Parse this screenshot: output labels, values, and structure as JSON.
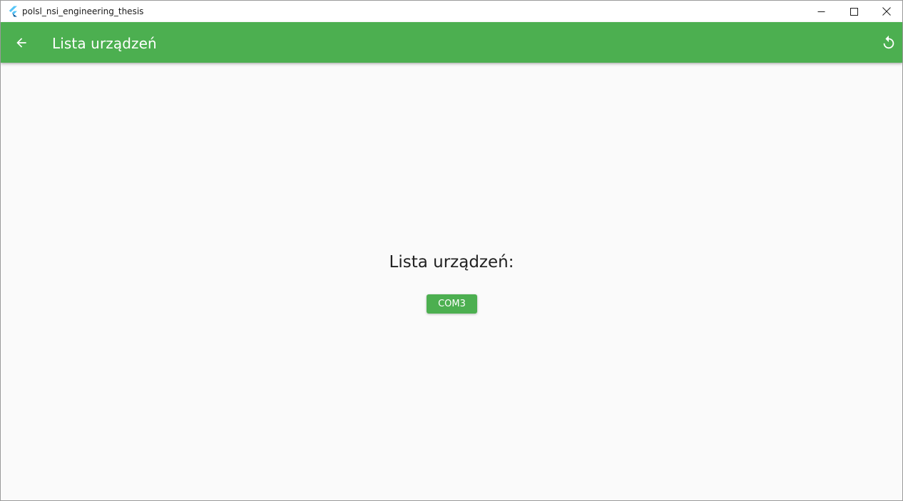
{
  "window": {
    "title": "polsl_nsi_engineering_thesis",
    "app_icon": "flutter-logo-icon",
    "controls": [
      "minimize-icon",
      "maximize-icon",
      "close-icon"
    ]
  },
  "appbar": {
    "title": "Lista urządzeń",
    "back_icon": "arrow-back-icon",
    "refresh_icon": "refresh-icon"
  },
  "main": {
    "heading": "Lista urządzeń:",
    "devices": [
      "COM3"
    ]
  },
  "colors": {
    "primary": "#4caf50",
    "background": "#fafafa",
    "text": "#212121"
  }
}
